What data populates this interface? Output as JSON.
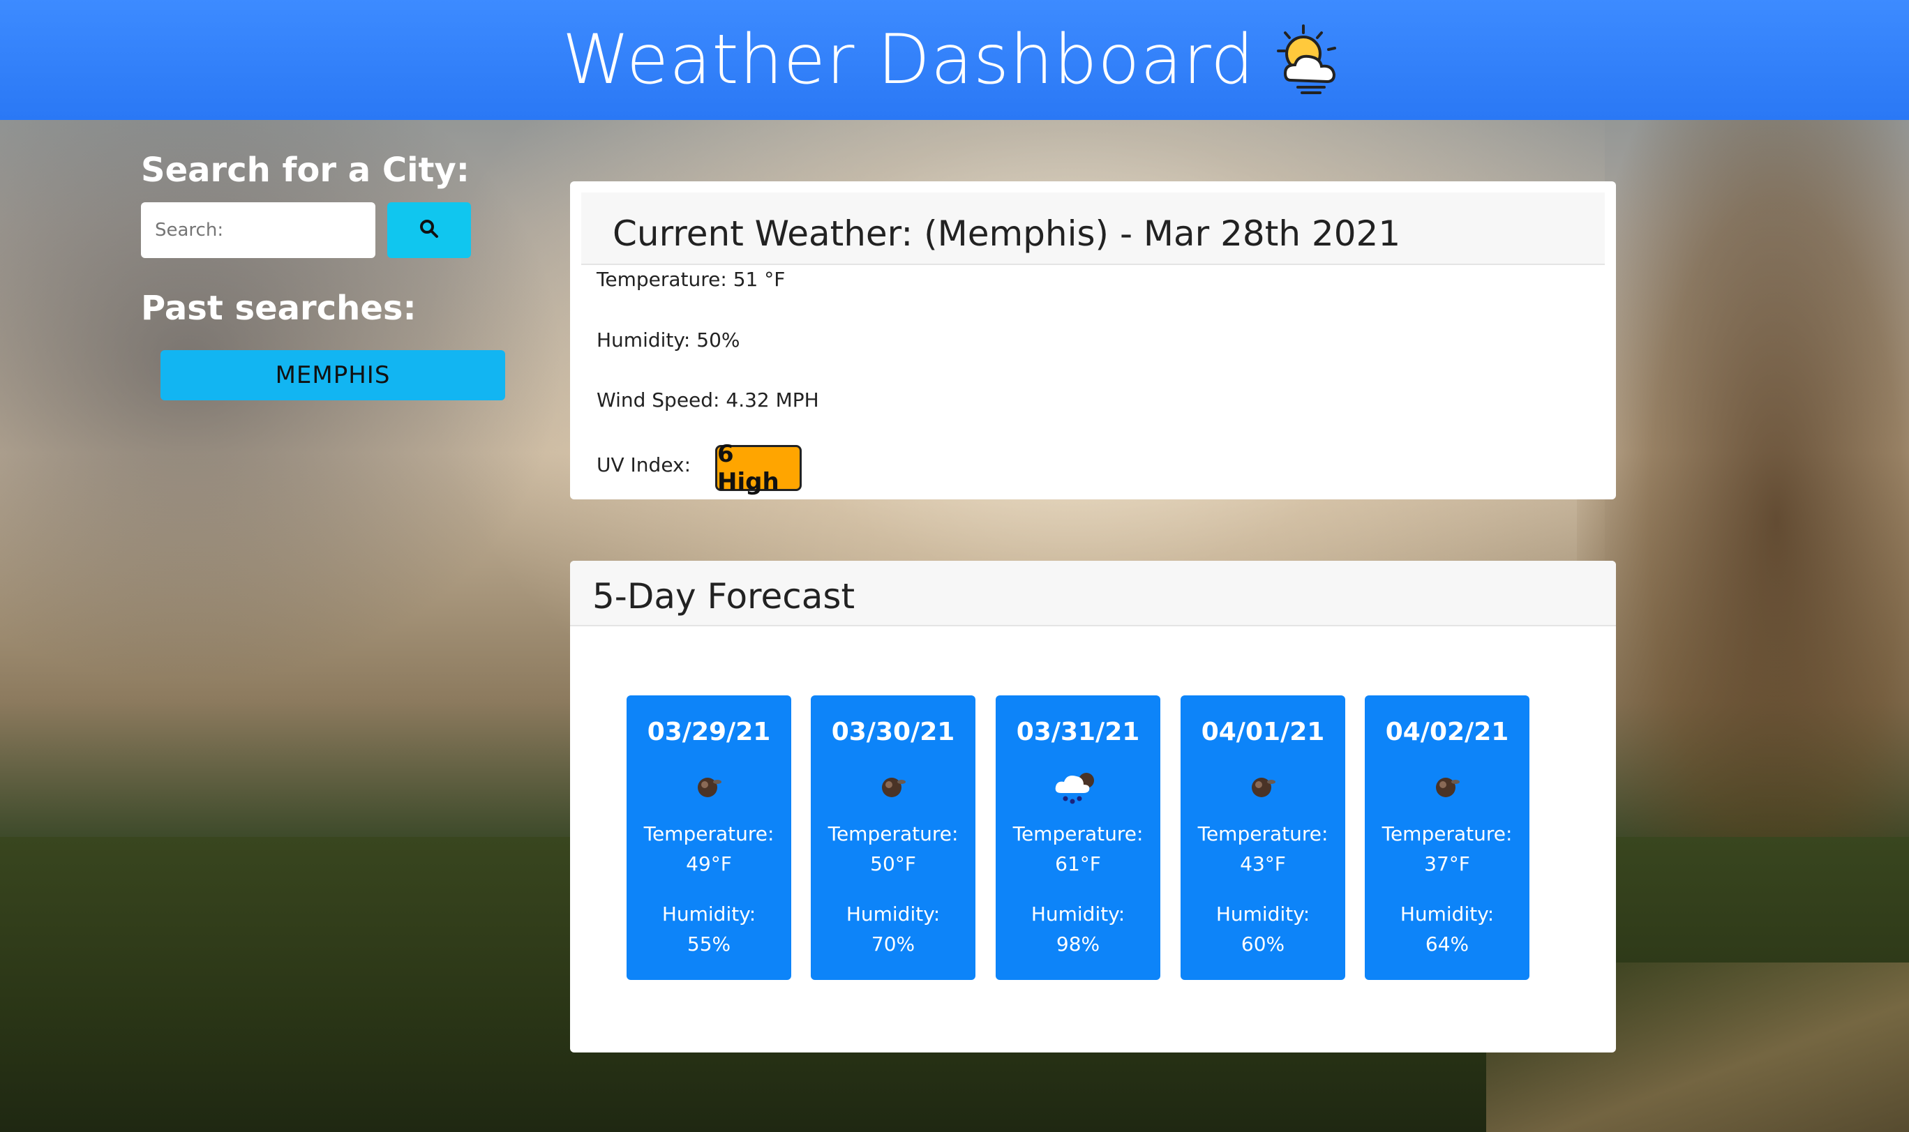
{
  "header": {
    "title": "Weather Dashboard",
    "icon": "sun-behind-cloud-icon"
  },
  "sidebar": {
    "search_heading": "Search for a City:",
    "search_placeholder": "Search:",
    "search_button_icon": "search-icon",
    "past_heading": "Past searches:",
    "past_searches": [
      "MEMPHIS"
    ]
  },
  "current": {
    "title": "Current Weather: (Memphis) - Mar 28th 2021",
    "temperature": "Temperature: 51 °F",
    "humidity": "Humidity: 50%",
    "wind": "Wind Speed: 4.32 MPH",
    "uv_label": "UV Index:",
    "uv_value": "6 High",
    "uv_color": "#ffa500"
  },
  "forecast": {
    "title": "5-Day Forecast",
    "days": [
      {
        "date": "03/29/21",
        "icon": "dark-sphere-icon",
        "temp_label": "Temperature:",
        "temp": "49°F",
        "hum_label": "Humidity:",
        "hum": "55%"
      },
      {
        "date": "03/30/21",
        "icon": "dark-sphere-icon",
        "temp_label": "Temperature:",
        "temp": "50°F",
        "hum_label": "Humidity:",
        "hum": "70%"
      },
      {
        "date": "03/31/21",
        "icon": "rain-cloud-icon",
        "temp_label": "Temperature:",
        "temp": "61°F",
        "hum_label": "Humidity:",
        "hum": "98%"
      },
      {
        "date": "04/01/21",
        "icon": "dark-sphere-icon",
        "temp_label": "Temperature:",
        "temp": "43°F",
        "hum_label": "Humidity:",
        "hum": "60%"
      },
      {
        "date": "04/02/21",
        "icon": "dark-sphere-icon",
        "temp_label": "Temperature:",
        "temp": "37°F",
        "hum_label": "Humidity:",
        "hum": "64%"
      }
    ]
  },
  "colors": {
    "header": "#2a78f5",
    "forecast_card": "#0d84f9",
    "search_button": "#10c6ef",
    "past_button": "#12b5f2"
  }
}
